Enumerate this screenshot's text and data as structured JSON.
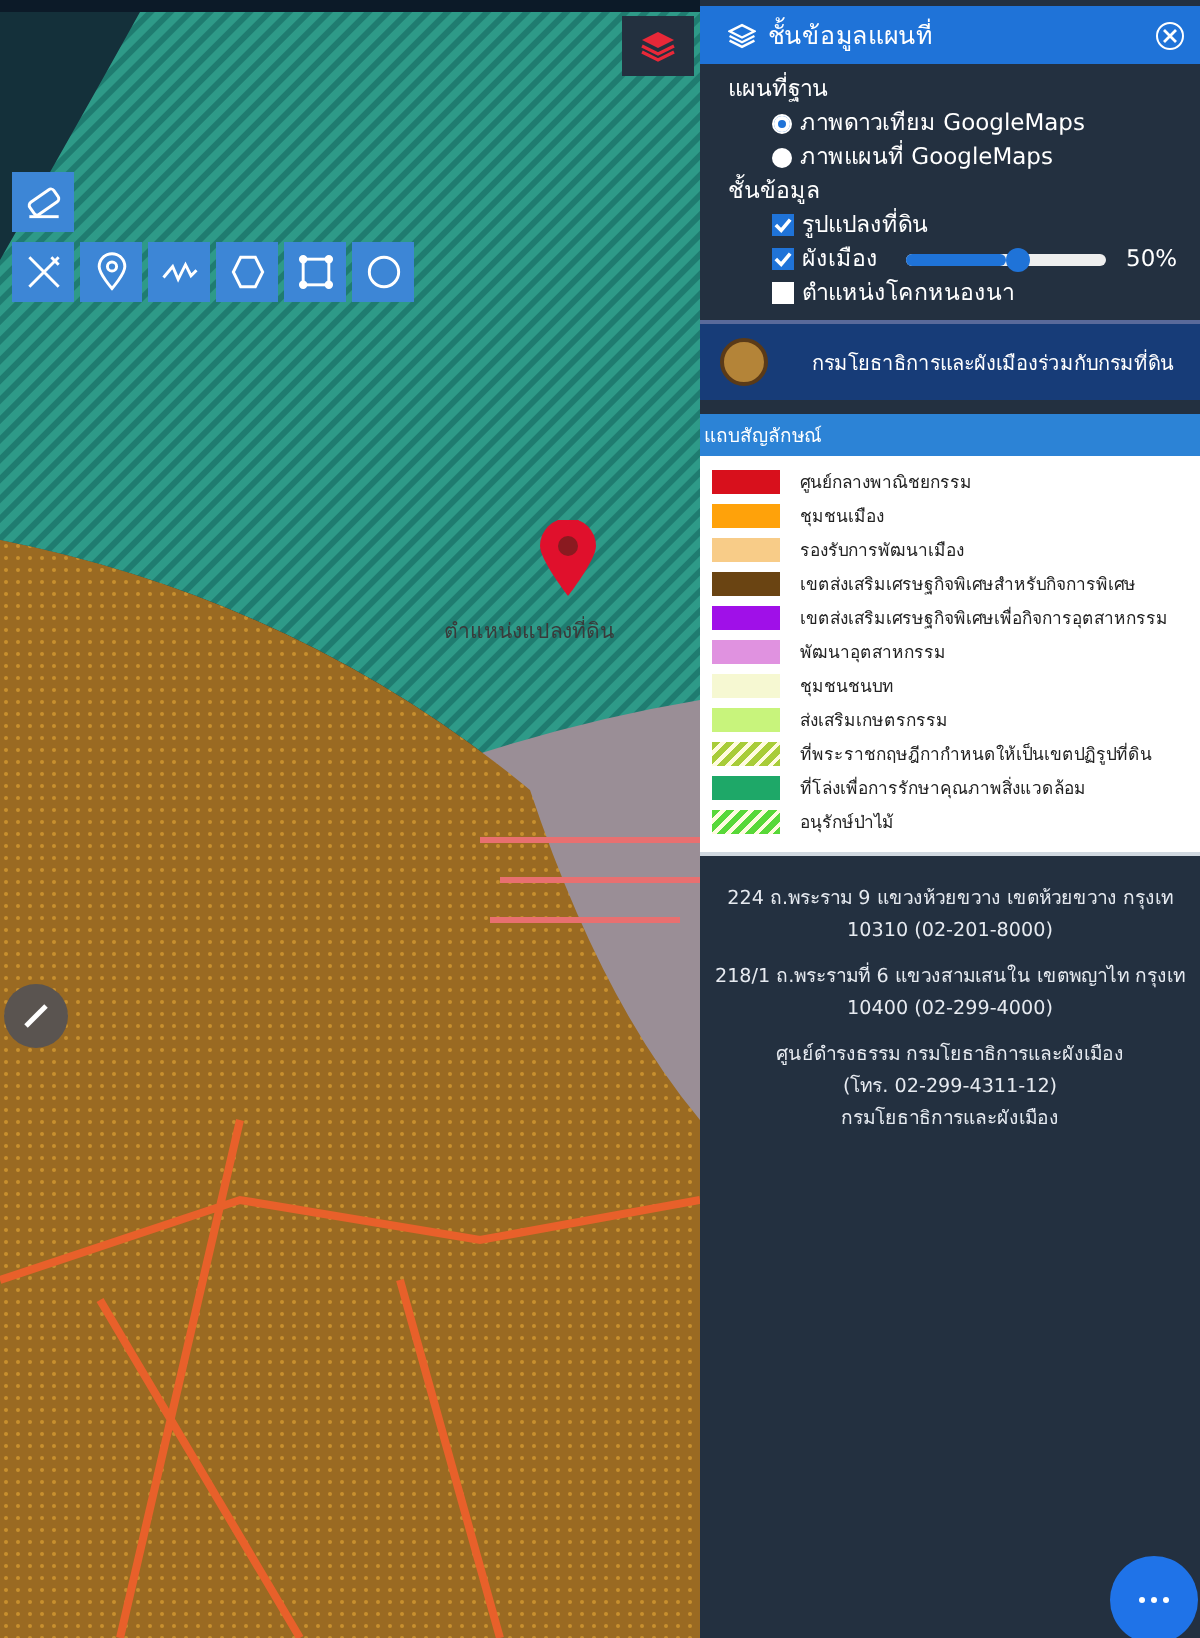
{
  "map": {
    "pin_label": "ตำแหน่งแปลงที่ดิน",
    "draw_tools": [
      {
        "kind": "eraser"
      },
      {
        "kind": "cross"
      },
      {
        "kind": "pin"
      },
      {
        "kind": "line"
      },
      {
        "kind": "polygon"
      },
      {
        "kind": "square"
      },
      {
        "kind": "circle"
      }
    ]
  },
  "layer_panel": {
    "title": "ชั้นข้อมูลแผนที่",
    "basemap_heading": "แผนที่ฐาน",
    "basemaps": [
      {
        "label": "ภาพดาวเทียม GoogleMaps",
        "selected": true
      },
      {
        "label": "ภาพแผนที่ GoogleMaps",
        "selected": false
      }
    ],
    "layers_heading": "ชั้นข้อมูล",
    "layers": [
      {
        "kind": "check",
        "label": "รูปแปลงที่ดิน",
        "checked": true
      },
      {
        "kind": "slider",
        "label": "ผังเมือง",
        "checked": true,
        "level": 0.5,
        "reading": "50%"
      },
      {
        "kind": "check",
        "label": "ตำแหน่งโคกหนองนา",
        "checked": false
      }
    ]
  },
  "agency_banner": {
    "title": "กรมโยธาธิการและผังเมืองร่วมกับกรมที่ดิน"
  },
  "legend": {
    "title": "แถบสัญลักษณ์",
    "items": [
      {
        "label": "ศูนย์กลางพาณิชยกรรม",
        "color": "#d8101c",
        "kind": "solid"
      },
      {
        "label": "ชุมชนเมือง",
        "color": "#ffa20a",
        "kind": "solid"
      },
      {
        "label": "รองรับการพัฒนาเมือง",
        "color": "#f8cc88",
        "kind": "solid"
      },
      {
        "label": "เขตส่งเสริมเศรษฐกิจพิเศษสำหรับกิจการพิเศษ",
        "color": "#6a4412",
        "kind": "solid"
      },
      {
        "label": "เขตส่งเสริมเศรษฐกิจพิเศษเพื่อกิจการอุตสาหกรรม",
        "color": "#a010e8",
        "kind": "solid"
      },
      {
        "label": "พัฒนาอุตสาหกรรม",
        "color": "#e092e0",
        "kind": "solid"
      },
      {
        "label": "ชุมชนชนบท",
        "color": "#f6f8d2",
        "kind": "solid"
      },
      {
        "label": "ส่งเสริมเกษตรกรรม",
        "color": "#c8f47c",
        "kind": "solid"
      },
      {
        "label": "ที่พระราชกฤษฎีกากำหนดให้เป็นเขตปฏิรูปที่ดิน",
        "color": "#a8cc38",
        "kind": "hatched"
      },
      {
        "label": "ที่โล่งเพื่อการรักษาคุณภาพสิ่งแวดล้อม",
        "color": "#1ea868",
        "kind": "solid"
      },
      {
        "label": "อนุรักษ์ป่าไม้",
        "color": "#58d838",
        "kind": "hatched"
      }
    ]
  },
  "contacts": [
    {
      "lines": [
        "224 ถ.พระราม 9 แขวงห้วยขวาง เขตห้วยขวาง กรุงเท",
        "10310 (02-201-8000)"
      ]
    },
    {
      "lines": [
        "218/1 ถ.พระรามที่ 6 แขวงสามเสนใน เขตพญาไท กรุงเท",
        "10400 (02-299-4000)"
      ]
    },
    {
      "lines": [
        "ศูนย์ดำรงธรรม กรมโยธาธิการและผังเมือง",
        "(โทร. 02-299-4311-12)",
        "กรมโยธาธิการและผังเมือง"
      ]
    }
  ]
}
